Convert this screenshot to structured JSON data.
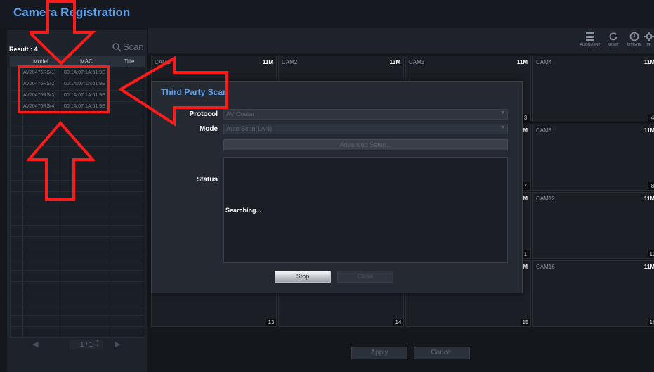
{
  "app": {
    "title": "Camera Registration"
  },
  "left_panel": {
    "result": "Result : 4",
    "scan_label": "Scan",
    "columns": [
      "Model",
      "MAC",
      "Title"
    ],
    "rows": [
      {
        "model": "AV20476RS(1)",
        "mac": "00:1A:07:1A:61:9E"
      },
      {
        "model": "AV20476RS(2)",
        "mac": "00:1A:07:1A:61:9E"
      },
      {
        "model": "AV20476RS(3)",
        "mac": "00:1A:07:1A:61:9E"
      },
      {
        "model": "AV20476RS(4)",
        "mac": "00:1A:07:1A:61:9E"
      }
    ],
    "page": "1 / 1"
  },
  "toolbar": {
    "alignment": "ALIGNMENT",
    "reset": "RESET",
    "bitrate": "BITRATE",
    "test": "TE"
  },
  "cameras": [
    {
      "name": "CAM1",
      "res": "11M",
      "num": ""
    },
    {
      "name": "CAM2",
      "res": "13M",
      "num": ""
    },
    {
      "name": "CAM3",
      "res": "11M",
      "num": "3"
    },
    {
      "name": "CAM4",
      "res": "11M",
      "num": "4"
    },
    {
      "name": "",
      "res": "",
      "num": ""
    },
    {
      "name": "",
      "res": "",
      "num": ""
    },
    {
      "name": "",
      "res": "M",
      "num": "7"
    },
    {
      "name": "CAM8",
      "res": "11M",
      "num": "8"
    },
    {
      "name": "",
      "res": "",
      "num": ""
    },
    {
      "name": "",
      "res": "",
      "num": ""
    },
    {
      "name": "",
      "res": "M",
      "num": "1"
    },
    {
      "name": "CAM12",
      "res": "11M",
      "num": "12"
    },
    {
      "name": "",
      "res": "",
      "num": "13"
    },
    {
      "name": "",
      "res": "",
      "num": "14"
    },
    {
      "name": "",
      "res": "M",
      "num": "15"
    },
    {
      "name": "CAM16",
      "res": "11M",
      "num": "16"
    }
  ],
  "bottom": {
    "apply": "Apply",
    "cancel": "Cancel"
  },
  "dialog": {
    "title": "Third Party Scan",
    "protocol_label": "Protocol",
    "protocol_value": "AV Costar",
    "mode_label": "Mode",
    "mode_value": "Auto Scan(LAN)",
    "advanced_label": "Advanced Setup...",
    "status_label": "Status",
    "status_text": "Searching...",
    "stop_label": "Stop",
    "close_label": "Close"
  },
  "colors": {
    "accent": "#5ea2ee",
    "annotation": "#ff1a1a",
    "background": "#14171c"
  }
}
